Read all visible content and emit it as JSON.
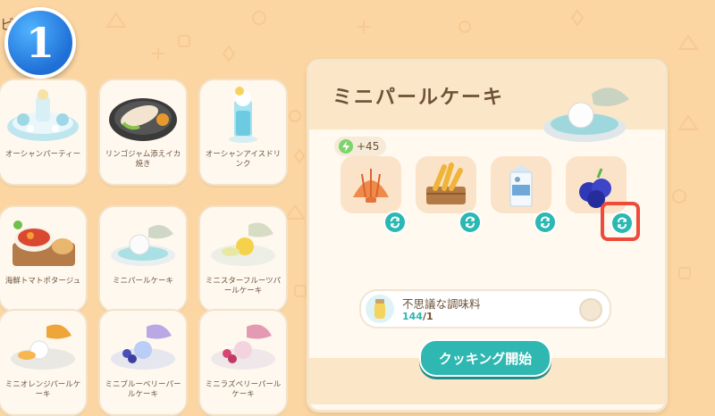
{
  "header": {
    "step_number": "1",
    "clipped_title": "ビ"
  },
  "recipes": [
    {
      "name": "オーシャンパーティー"
    },
    {
      "name": "リンゴジャム添えイカ焼き"
    },
    {
      "name": "オーシャンアイスドリンク"
    },
    {
      "name": "海鮮トマトポタージュ"
    },
    {
      "name": "ミニパールケーキ"
    },
    {
      "name": "ミニスターフルーツパールケーキ"
    },
    {
      "name": "ミニオレンジパールケーキ"
    },
    {
      "name": "ミニブルーベリーパールケーキ"
    },
    {
      "name": "ミニラズベリーパールケーキ"
    }
  ],
  "detail": {
    "title": "ミニパールケーキ",
    "energy": "+45",
    "ingredients": [
      {
        "icon": "scallop-icon"
      },
      {
        "icon": "wheat-crate-icon"
      },
      {
        "icon": "milk-carton-icon"
      },
      {
        "icon": "blueberry-icon"
      }
    ],
    "seasoning": {
      "name": "不思議な調味料",
      "have": "144",
      "need": "/1"
    },
    "cook_button": "クッキング開始"
  },
  "colors": {
    "background": "#fbd6a3",
    "accent_teal": "#2bb8b3",
    "highlight_red": "#ef4b3a",
    "badge_blue": "#1f6fd6"
  }
}
